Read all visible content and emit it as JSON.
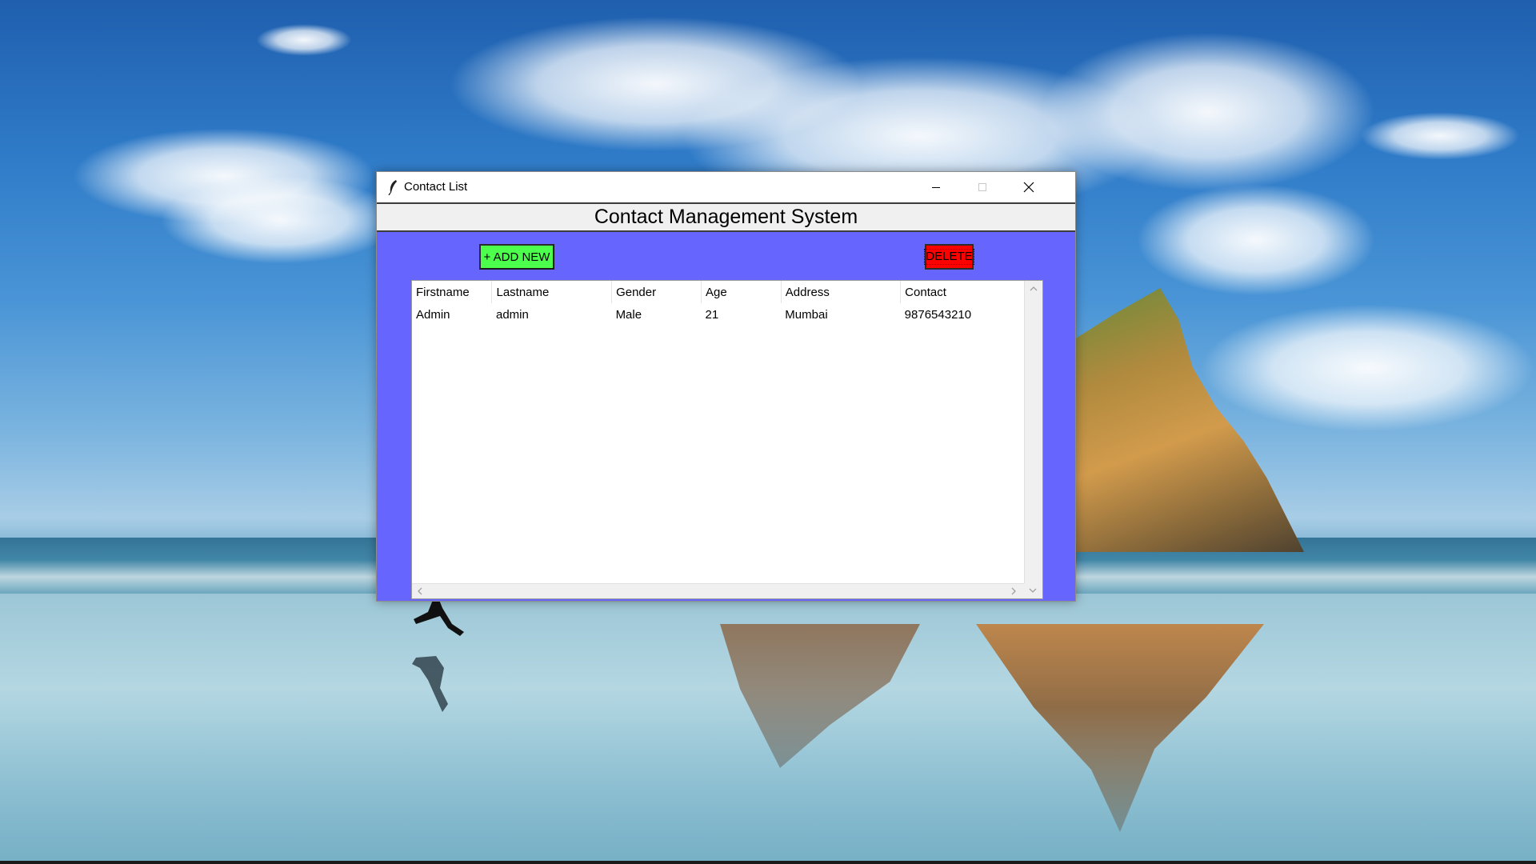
{
  "window": {
    "title": "Contact List",
    "heading": "Contact Management System"
  },
  "toolbar": {
    "add_label": "+ ADD NEW",
    "delete_label": "DELETE",
    "add_color": "#4cff4c",
    "delete_color": "#ff0000",
    "background_color": "#6666ff"
  },
  "table": {
    "columns": [
      "Firstname",
      "Lastname",
      "Gender",
      "Age",
      "Address",
      "Contact"
    ],
    "rows": [
      [
        "Admin",
        "admin",
        "Male",
        "21",
        "Mumbai",
        "9876543210"
      ]
    ]
  },
  "icons": {
    "app": "feather-icon",
    "minimize": "minimize-icon",
    "maximize": "maximize-icon",
    "close": "close-icon"
  }
}
